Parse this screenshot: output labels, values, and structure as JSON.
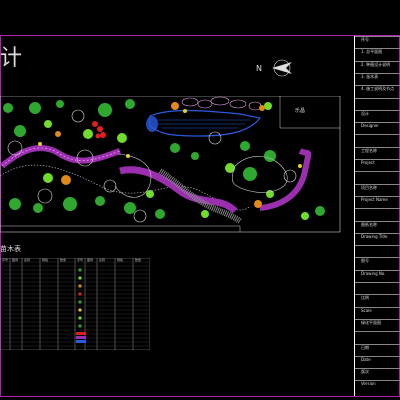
{
  "drawing": {
    "title_fragment": "计",
    "north_label": "N",
    "plan_label": "乐昌"
  },
  "title_block": {
    "rows": [
      "序号",
      "1. 总平面图",
      "2. 种植设计说明",
      "3. 苗木表",
      "4. 施工说明及节点",
      "",
      "设计",
      "Designer",
      "",
      "工程名称",
      "Project",
      "",
      "项目名称",
      "Project Name",
      "",
      "图纸名称",
      "Drawing Title",
      "",
      "图号",
      "Drawing No.",
      "",
      "比例",
      "Scale",
      "绿化平面图",
      "",
      "日期",
      "Date",
      "版次",
      "Version"
    ]
  },
  "legend": {
    "title": "苗木表",
    "headers": [
      "序号",
      "图例",
      "名称",
      "规格",
      "数量",
      "序号",
      "图例",
      "名称",
      "规格",
      "数量"
    ]
  },
  "colors": {
    "frame": "#b01fb0",
    "path_purple": "#9b2fb0",
    "tree_green": "#2ea82e",
    "light_green": "#6fdc2e",
    "orange": "#e08a1a",
    "red": "#e02020",
    "blue_water": "#2a5ae0",
    "yellow": "#e0d020"
  }
}
